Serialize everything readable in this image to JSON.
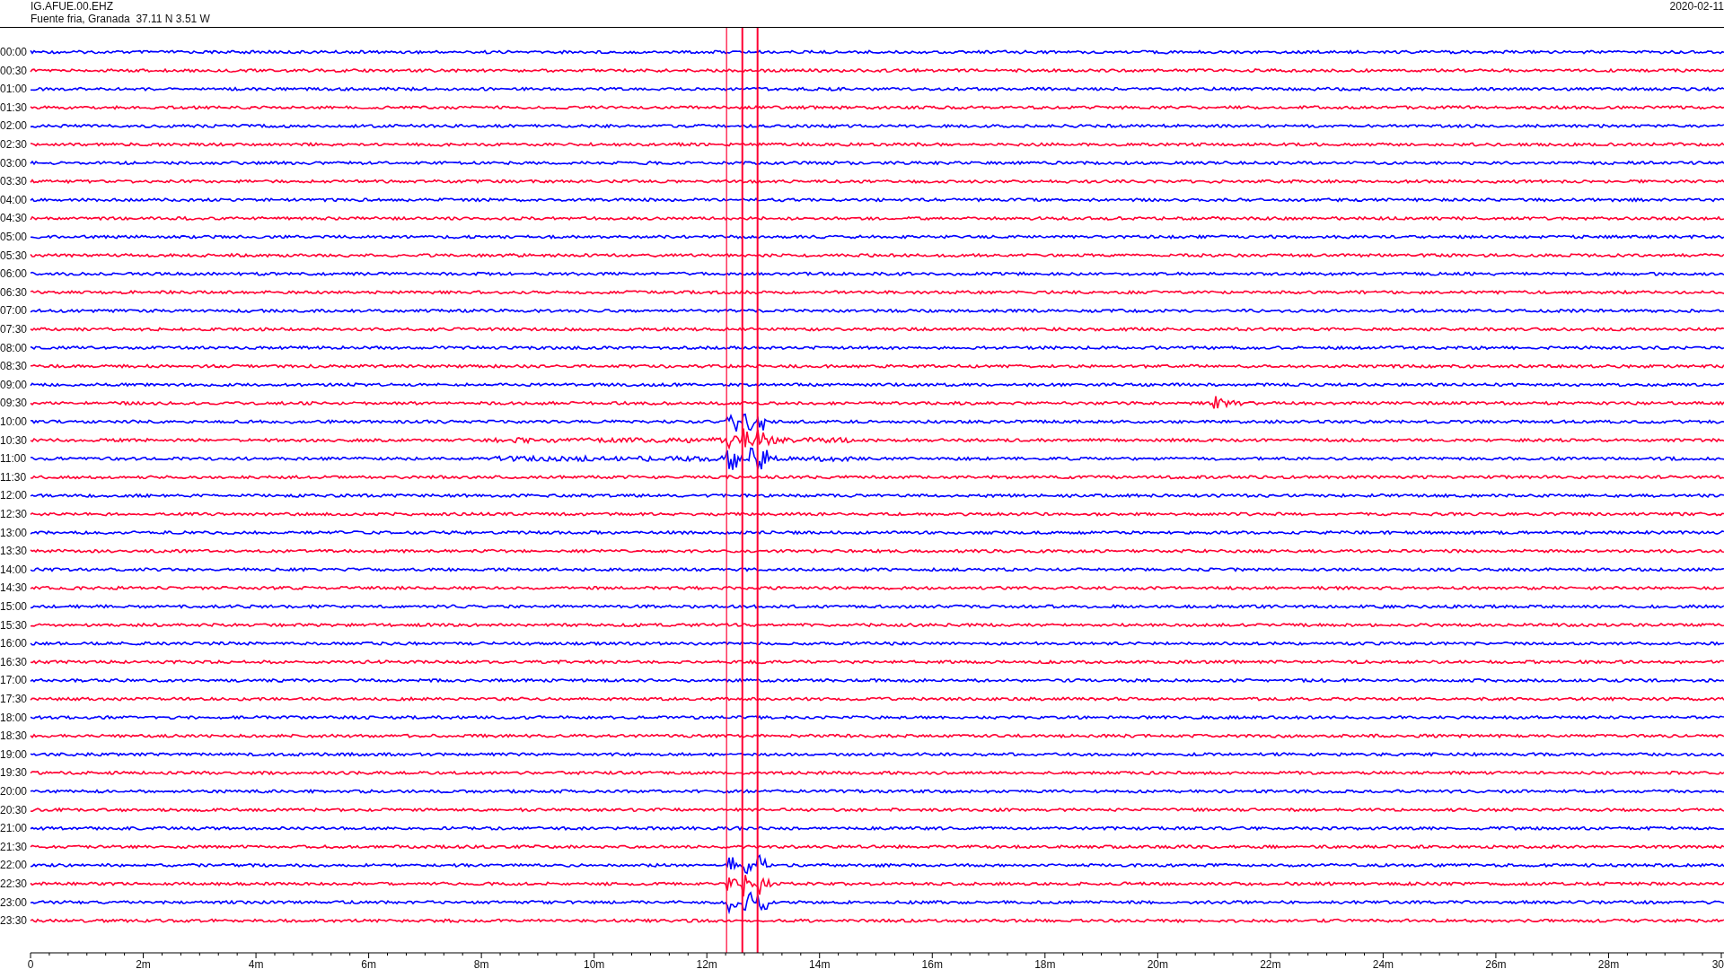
{
  "header": {
    "station": "IG.AFUE.00.EHZ",
    "location": "Fuente fria, Granada  37.11 N 3.51 W",
    "date": "2020-02-11"
  },
  "traces": [
    {
      "label": "00:00",
      "color": "#0000ff"
    },
    {
      "label": "00:30",
      "color": "#ff0033"
    },
    {
      "label": "01:00",
      "color": "#0000ff"
    },
    {
      "label": "01:30",
      "color": "#ff0033"
    },
    {
      "label": "02:00",
      "color": "#0000ff"
    },
    {
      "label": "02:30",
      "color": "#ff0033"
    },
    {
      "label": "03:00",
      "color": "#0000ff"
    },
    {
      "label": "03:30",
      "color": "#ff0033"
    },
    {
      "label": "04:00",
      "color": "#0000ff"
    },
    {
      "label": "04:30",
      "color": "#ff0033"
    },
    {
      "label": "05:00",
      "color": "#0000ff"
    },
    {
      "label": "05:30",
      "color": "#ff0033"
    },
    {
      "label": "06:00",
      "color": "#0000ff"
    },
    {
      "label": "06:30",
      "color": "#ff0033"
    },
    {
      "label": "07:00",
      "color": "#0000ff"
    },
    {
      "label": "07:30",
      "color": "#ff0033"
    },
    {
      "label": "08:00",
      "color": "#0000ff"
    },
    {
      "label": "08:30",
      "color": "#ff0033"
    },
    {
      "label": "09:00",
      "color": "#0000ff"
    },
    {
      "label": "09:30",
      "color": "#ff0033"
    },
    {
      "label": "10:00",
      "color": "#0000ff"
    },
    {
      "label": "10:30",
      "color": "#ff0033"
    },
    {
      "label": "11:00",
      "color": "#0000ff"
    },
    {
      "label": "11:30",
      "color": "#ff0033"
    },
    {
      "label": "12:00",
      "color": "#0000ff"
    },
    {
      "label": "12:30",
      "color": "#ff0033"
    },
    {
      "label": "13:00",
      "color": "#0000ff"
    },
    {
      "label": "13:30",
      "color": "#ff0033"
    },
    {
      "label": "14:00",
      "color": "#0000ff"
    },
    {
      "label": "14:30",
      "color": "#ff0033"
    },
    {
      "label": "15:00",
      "color": "#0000ff"
    },
    {
      "label": "15:30",
      "color": "#ff0033"
    },
    {
      "label": "16:00",
      "color": "#0000ff"
    },
    {
      "label": "16:30",
      "color": "#ff0033"
    },
    {
      "label": "17:00",
      "color": "#0000ff"
    },
    {
      "label": "17:30",
      "color": "#ff0033"
    },
    {
      "label": "18:00",
      "color": "#0000ff"
    },
    {
      "label": "18:30",
      "color": "#ff0033"
    },
    {
      "label": "19:00",
      "color": "#0000ff"
    },
    {
      "label": "19:30",
      "color": "#ff0033"
    },
    {
      "label": "20:00",
      "color": "#0000ff"
    },
    {
      "label": "20:30",
      "color": "#ff0033"
    },
    {
      "label": "21:00",
      "color": "#0000ff"
    },
    {
      "label": "21:30",
      "color": "#ff0033"
    },
    {
      "label": "22:00",
      "color": "#0000ff"
    },
    {
      "label": "22:30",
      "color": "#ff0033"
    },
    {
      "label": "23:00",
      "color": "#0000ff"
    },
    {
      "label": "23:30",
      "color": "#ff0033"
    }
  ],
  "axis": {
    "ticks": [
      "0",
      "2m",
      "4m",
      "6m",
      "8m",
      "10m",
      "12m",
      "14m",
      "16m",
      "18m",
      "20m",
      "22m",
      "24m",
      "26m",
      "28m",
      "30"
    ]
  }
}
